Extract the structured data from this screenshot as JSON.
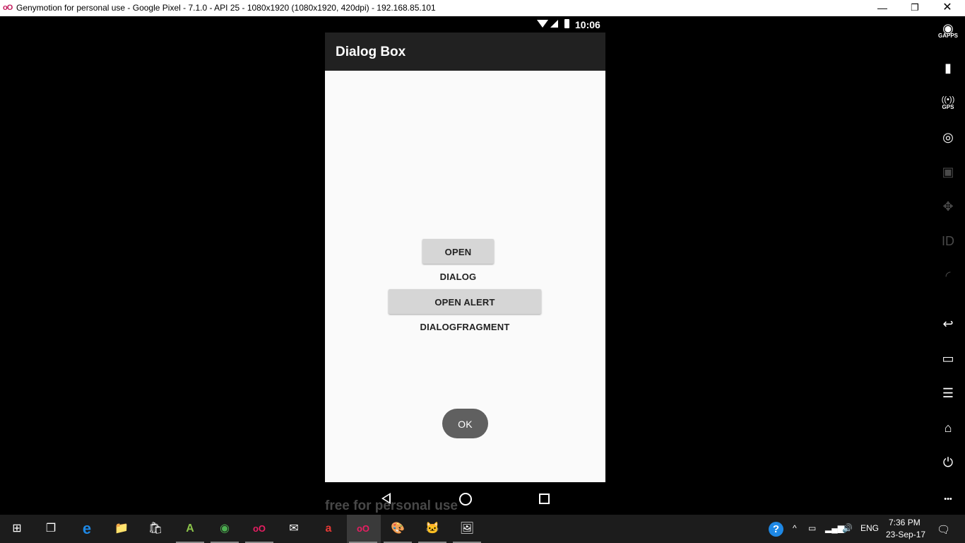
{
  "window": {
    "title": "Genymotion for personal use - Google Pixel - 7.1.0 - API 25 - 1080x1920 (1080x1920, 420dpi) - 192.168.85.101",
    "app_icon_glyph": "oO",
    "minimize": "—",
    "maximize": "❐",
    "close": "✕"
  },
  "phone": {
    "status_bar": {
      "time": "10:06"
    },
    "app_title": "Dialog Box",
    "buttons": {
      "open_dialog": "OPEN DIALOG",
      "open_alert": "OPEN ALERT DIALOGFRAGMENT",
      "ok": "OK"
    },
    "watermark": "free for personal use"
  },
  "right_toolbar": [
    {
      "icon": "gapps-icon",
      "glyph": "◉",
      "caption": "GAPPS"
    },
    {
      "icon": "battery-icon",
      "glyph": "▮",
      "caption": ""
    },
    {
      "icon": "gps-icon",
      "glyph": "((•))",
      "caption": "GPS"
    },
    {
      "icon": "webcam-icon",
      "glyph": "◎",
      "caption": ""
    },
    {
      "icon": "screencast-icon",
      "glyph": "▣",
      "caption": ""
    },
    {
      "icon": "dpad-icon",
      "glyph": "✥",
      "caption": ""
    },
    {
      "icon": "device-id-icon",
      "glyph": "ID",
      "caption": ""
    },
    {
      "icon": "network-icon",
      "glyph": "◜",
      "caption": ""
    },
    {
      "icon": "back-icon",
      "glyph": "↩",
      "caption": ""
    },
    {
      "icon": "recent-apps-icon",
      "glyph": "▭",
      "caption": ""
    },
    {
      "icon": "menu-icon",
      "glyph": "☰",
      "caption": ""
    },
    {
      "icon": "home-icon",
      "glyph": "⌂",
      "caption": ""
    },
    {
      "icon": "power-icon",
      "glyph": "⏻",
      "caption": ""
    },
    {
      "icon": "more-icon",
      "glyph": "•••",
      "caption": ""
    }
  ],
  "taskbar": {
    "apps": [
      {
        "icon": "windows-start-icon",
        "glyph": "⊞"
      },
      {
        "icon": "task-view-icon",
        "glyph": "❐"
      },
      {
        "icon": "edge-icon",
        "glyph": "e"
      },
      {
        "icon": "file-explorer-icon",
        "glyph": "📁"
      },
      {
        "icon": "store-icon",
        "glyph": "🛍"
      },
      {
        "icon": "android-studio-icon",
        "glyph": "A"
      },
      {
        "icon": "chrome-icon",
        "glyph": "◉"
      },
      {
        "icon": "genymotion-icon",
        "glyph": "oO"
      },
      {
        "icon": "mail-icon",
        "glyph": "✉"
      },
      {
        "icon": "airtel-icon",
        "glyph": "a"
      },
      {
        "icon": "genymotion-active-icon",
        "glyph": "oO"
      },
      {
        "icon": "paint-icon",
        "glyph": "🎨"
      },
      {
        "icon": "github-icon",
        "glyph": "🐱"
      },
      {
        "icon": "image-viewer-icon",
        "glyph": "🖼"
      }
    ],
    "tray": {
      "help": "?",
      "chevron": "^",
      "language": "ENG",
      "time": "7:36 PM",
      "date": "23-Sep-17",
      "notifications": "🗨"
    }
  }
}
